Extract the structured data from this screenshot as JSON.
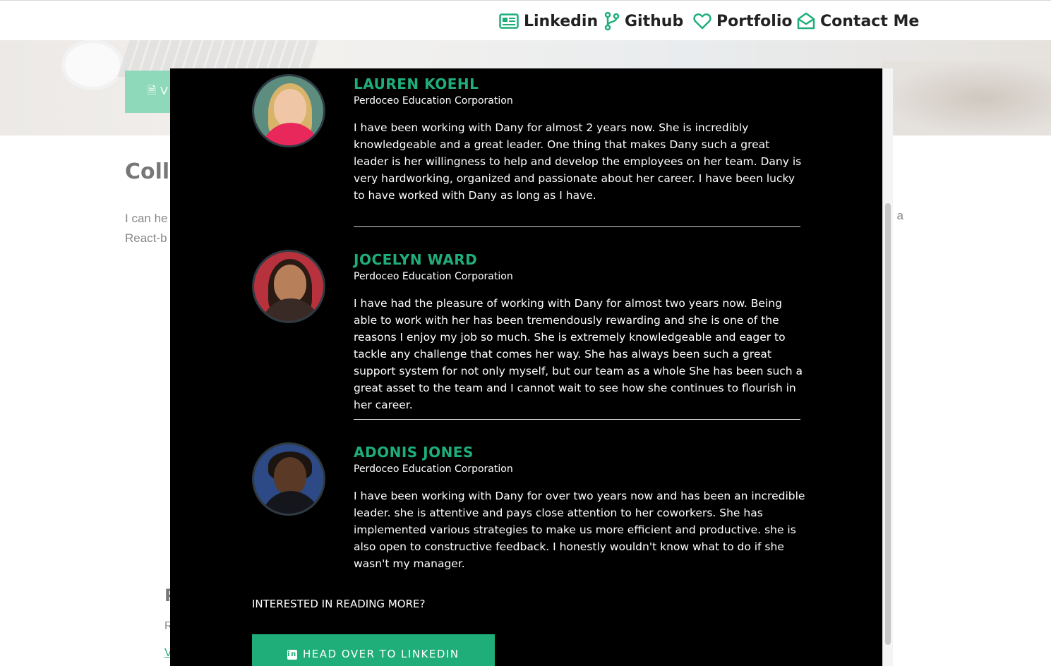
{
  "nav": {
    "items": [
      {
        "label": "Linkedin",
        "icon": "id-card-icon"
      },
      {
        "label": "Github",
        "icon": "git-branch-icon"
      },
      {
        "label": "Portfolio",
        "icon": "heart-icon"
      },
      {
        "label": "Contact Me",
        "icon": "envelope-open-icon"
      }
    ],
    "accent": "#1fae7a"
  },
  "background": {
    "resume_button_label": "V",
    "heading": "Colla",
    "text_line1": "I can he",
    "text_line2": "React-b",
    "text_right": "l a",
    "small_heading": "P",
    "small_text": "R",
    "small_link": "V"
  },
  "modal": {
    "testimonials": [
      {
        "name": "LAUREN KOEHL",
        "company": "Perdoceo Education Corporation",
        "text": "I have been working with Dany for almost 2 years now. She is incredibly knowledgeable and a great leader. One thing that makes Dany such a great leader is her willingness to help and develop the employees on her team. Dany is very hardworking, organized and passionate about her career. I have been lucky to have worked with Dany as long as I have."
      },
      {
        "name": "JOCELYN WARD",
        "company": "Perdoceo Education Corporation",
        "text": "I have had the pleasure of working with Dany for almost two years now. Being able to work with her has been tremendously rewarding and she is one of the reasons I enjoy my job so much. She is extremely knowledgeable and eager to tackle any challenge that comes her way. She has always been such a great support system for not only myself, but our team as a whole She has been such a great asset to the team and I cannot wait to see how she continues to flourish in her career."
      },
      {
        "name": "ADONIS JONES",
        "company": "Perdoceo Education Corporation",
        "text": "I have been working with Dany for over two years now and has been an incredible leader. she is attentive and pays close attention to her coworkers. She has implemented various strategies to make us more efficient and productive. she is also open to constructive feedback. I honestly wouldn't know what to do if she wasn't my manager."
      }
    ],
    "more_label": "INTERESTED IN READING MORE?",
    "linkedin_button": "HEAD OVER TO LINKEDIN",
    "linkedin_button_icon": "linkedin-icon"
  }
}
